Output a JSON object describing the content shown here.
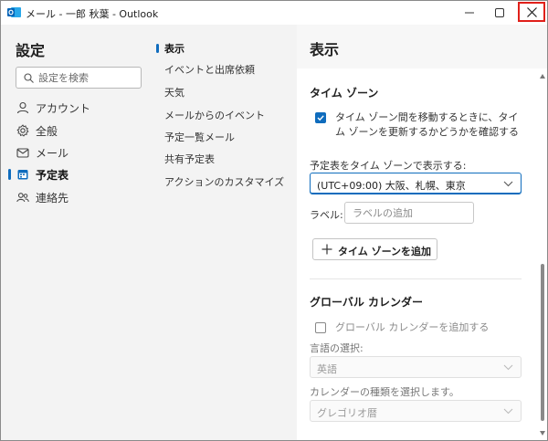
{
  "window": {
    "title": "メール - 一郎 秋葉 - Outlook",
    "app_icon": "outlook-icon",
    "controls": {
      "minimize": "minimize-icon",
      "maximize": "maximize-icon",
      "close": "close-icon"
    }
  },
  "leftnav": {
    "title": "設定",
    "search_placeholder": "設定を検索",
    "items": [
      {
        "label": "アカウント",
        "icon": "person-icon",
        "active": false
      },
      {
        "label": "全般",
        "icon": "gear-icon",
        "active": false
      },
      {
        "label": "メール",
        "icon": "mail-icon",
        "active": false
      },
      {
        "label": "予定表",
        "icon": "calendar-icon",
        "active": true
      },
      {
        "label": "連絡先",
        "icon": "people-icon",
        "active": false
      }
    ]
  },
  "subnav": {
    "items": [
      {
        "label": "表示",
        "active": true
      },
      {
        "label": "イベントと出席依頼",
        "active": false
      },
      {
        "label": "天気",
        "active": false
      },
      {
        "label": "メールからのイベント",
        "active": false
      },
      {
        "label": "予定一覧メール",
        "active": false
      },
      {
        "label": "共有予定表",
        "active": false
      },
      {
        "label": "アクションのカスタマイズ",
        "active": false
      }
    ]
  },
  "panel": {
    "title": "表示",
    "timezone": {
      "heading": "タイム ゾーン",
      "update_checkbox_label": "タイム ゾーン間を移動するときに、タイム ゾーンを更新するかどうかを確認する",
      "update_checked": true,
      "display_label": "予定表をタイム ゾーンで表示する:",
      "display_value": "(UTC+09:00) 大阪、札幌、東京",
      "label_label": "ラベル:",
      "label_placeholder": "ラベルの追加",
      "add_button": "タイム ゾーンを追加"
    },
    "global_calendar": {
      "heading": "グローバル カレンダー",
      "add_checkbox_label": "グローバル カレンダーを追加する",
      "add_checked": false,
      "language_label": "言語の選択:",
      "language_value": "英語",
      "calendar_type_label": "カレンダーの種類を選択します。",
      "calendar_type_value": "グレゴリオ暦"
    }
  },
  "colors": {
    "accent": "#0f6cbd",
    "close_highlight": "#e0201a"
  }
}
